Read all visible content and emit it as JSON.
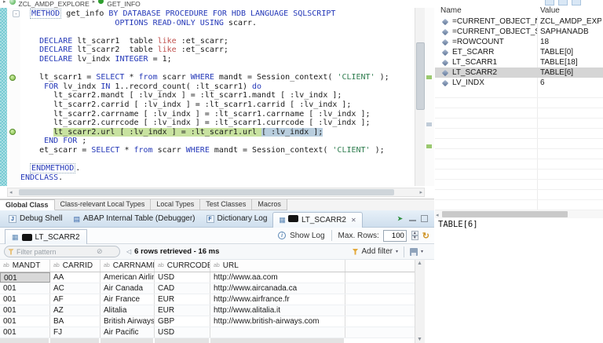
{
  "breadcrumb": {
    "class_name": "ZCL_AMDP_EXPLORE",
    "method_name": "GET_INFO"
  },
  "colors": {
    "keyword_blue": "#2438b8",
    "string_green": "#2f7d4f",
    "like_red": "#c0504d",
    "highlight_green": "#c8e2a0",
    "selection_blue": "#b9cede",
    "gutter_teal": "#79cbd3",
    "marker_green": "#7fbf45",
    "tabbar_blue": "#cfdfee",
    "funnel_gold": "#e3a93c"
  },
  "icons": {
    "fold_minus": "-",
    "debug_shell_badge": "J",
    "dictionary_log_badge": "F",
    "internal_table_glyph": "▤",
    "grid_glyph": "▦",
    "close_x": "✕",
    "info_i": "i",
    "refresh": "↻",
    "clear_filter": "⊘",
    "status_marker": "◁",
    "column_type": "ab",
    "dropdown_caret": "▾",
    "scroll_up": "▲",
    "scroll_down": "▼",
    "scroll_left": "◂",
    "scroll_right": "▸",
    "crumb_caret": "▸"
  },
  "editor": {
    "code_lines": [
      [
        [
          "p",
          "  "
        ],
        [
          "kbox",
          "METHOD"
        ],
        [
          "p",
          " get_info "
        ],
        [
          "k",
          "BY DATABASE PROCEDURE FOR HDB LANGUAGE SQLSCRIPT"
        ]
      ],
      [
        [
          "p",
          "                    "
        ],
        [
          "k",
          "OPTIONS READ-ONLY USING"
        ],
        [
          "p",
          " scarr."
        ]
      ],
      [
        [
          "p",
          ""
        ]
      ],
      [
        [
          "p",
          "    "
        ],
        [
          "k",
          "DECLARE"
        ],
        [
          "p",
          " lt_scarr1  table "
        ],
        [
          "r",
          "like"
        ],
        [
          "p",
          " :et_scarr;"
        ]
      ],
      [
        [
          "p",
          "    "
        ],
        [
          "k",
          "DECLARE"
        ],
        [
          "p",
          " lt_scarr2  table "
        ],
        [
          "r",
          "like"
        ],
        [
          "p",
          " :et_scarr;"
        ]
      ],
      [
        [
          "p",
          "    "
        ],
        [
          "k",
          "DECLARE"
        ],
        [
          "p",
          " lv_indx "
        ],
        [
          "k",
          "INTEGER"
        ],
        [
          "p",
          " = 1;"
        ]
      ],
      [
        [
          "p",
          ""
        ]
      ],
      [
        [
          "p",
          "    lt_scarr1 = "
        ],
        [
          "k",
          "SELECT"
        ],
        [
          "p",
          " * "
        ],
        [
          "k",
          "from"
        ],
        [
          "p",
          " scarr "
        ],
        [
          "k",
          "WHERE"
        ],
        [
          "p",
          " mandt = Session_context( "
        ],
        [
          "s",
          "'CLIENT'"
        ],
        [
          "p",
          " );"
        ]
      ],
      [
        [
          "p",
          "     "
        ],
        [
          "k",
          "FOR"
        ],
        [
          "p",
          " lv_indx "
        ],
        [
          "k",
          "IN"
        ],
        [
          "p",
          " 1..record_count( :lt_scarr1) "
        ],
        [
          "k",
          "do"
        ]
      ],
      [
        [
          "p",
          "       lt_scarr2.mandt [ :lv_indx ] = :lt_scarr1.mandt [ :lv_indx ];"
        ]
      ],
      [
        [
          "p",
          "       lt_scarr2.carrid [ :lv_indx ] = :lt_scarr1.carrid [ :lv_indx ];"
        ]
      ],
      [
        [
          "p",
          "       lt_scarr2.carrname [ :lv_indx ] = :lt_scarr1.carrname [ :lv_indx ];"
        ]
      ],
      [
        [
          "p",
          "       lt_scarr2.currcode [ :lv_indx ] = :lt_scarr1.currcode [ :lv_indx ];"
        ]
      ],
      [
        [
          "p",
          "       "
        ],
        [
          "hlg",
          "lt_scarr2.url [ :lv_indx ] = :lt_scarr1.url "
        ],
        [
          "psel",
          "[ :lv_indx ];"
        ]
      ],
      [
        [
          "p",
          "     "
        ],
        [
          "k",
          "END FOR"
        ],
        [
          "p",
          " ;"
        ]
      ],
      [
        [
          "p",
          "    et_scarr = "
        ],
        [
          "k",
          "SELECT"
        ],
        [
          "p",
          " * "
        ],
        [
          "k",
          "from"
        ],
        [
          "k",
          ""
        ],
        [
          "p",
          " scarr "
        ],
        [
          "k",
          "WHERE"
        ],
        [
          "p",
          " mandt = Session_context( "
        ],
        [
          "s",
          "'CLIENT'"
        ],
        [
          "p",
          " );"
        ]
      ],
      [
        [
          "p",
          ""
        ]
      ],
      [
        [
          "p",
          "  "
        ],
        [
          "kbox",
          "ENDMETHOD"
        ],
        [
          "p",
          "."
        ]
      ],
      [
        [
          "k",
          "ENDCLASS"
        ],
        [
          "p",
          "."
        ]
      ]
    ],
    "gutter_markers": [
      {
        "line": 7
      },
      {
        "line": 13
      }
    ],
    "fold_markers": [
      {
        "line": 0
      }
    ]
  },
  "class_tabs": {
    "items": [
      "Global Class",
      "Class-relevant Local Types",
      "Local Types",
      "Test Classes",
      "Macros"
    ],
    "active_index": 0
  },
  "view_tabs": {
    "items": [
      {
        "label": "Debug Shell",
        "icon": "badge-j",
        "active": false
      },
      {
        "label": "ABAP Internal Table (Debugger)",
        "icon": "internal-table",
        "active": false
      },
      {
        "label": "Dictionary Log",
        "icon": "badge-f",
        "active": false
      },
      {
        "label": "LT_SCARR2",
        "icon": "table-dark",
        "active": true,
        "closable": true
      }
    ]
  },
  "table_view": {
    "tab_label": "LT_SCARR2",
    "show_log_label": "Show Log",
    "max_rows_label": "Max. Rows:",
    "max_rows_value": "100",
    "filter_placeholder": "Filter pattern",
    "status_text": "6 rows retrieved - 16 ms",
    "add_filter_label": "Add filter",
    "columns": [
      "MANDT",
      "CARRID",
      "CARRNAME",
      "CURRCODE",
      "URL"
    ],
    "rows": [
      [
        "001",
        "AA",
        "American Airlines",
        "USD",
        "http://www.aa.com"
      ],
      [
        "001",
        "AC",
        "Air Canada",
        "CAD",
        "http://www.aircanada.ca"
      ],
      [
        "001",
        "AF",
        "Air France",
        "EUR",
        "http://www.airfrance.fr"
      ],
      [
        "001",
        "AZ",
        "Alitalia",
        "EUR",
        "http://www.alitalia.it"
      ],
      [
        "001",
        "BA",
        "British Airways",
        "GBP",
        "http://www.british-airways.com"
      ],
      [
        "001",
        "FJ",
        "Air Pacific",
        "USD",
        ""
      ]
    ],
    "selected_cell": {
      "row": 0,
      "col": 0
    }
  },
  "variables": {
    "name_header": "Name",
    "value_header": "Value",
    "rows": [
      {
        "name": "=CURRENT_OBJECT_NAME",
        "value": "ZCL_AMDP_EXPLORE=>G"
      },
      {
        "name": "=CURRENT_OBJECT_SCHEM",
        "value": "SAPHANADB"
      },
      {
        "name": "=ROWCOUNT",
        "value": "18"
      },
      {
        "name": "ET_SCARR",
        "value": "TABLE[0]"
      },
      {
        "name": "LT_SCARR1",
        "value": "TABLE[18]"
      },
      {
        "name": "LT_SCARR2",
        "value": "TABLE[6]"
      },
      {
        "name": "LV_INDX",
        "value": "6"
      }
    ],
    "selected_index": 5,
    "detail_value": "TABLE[6]"
  }
}
